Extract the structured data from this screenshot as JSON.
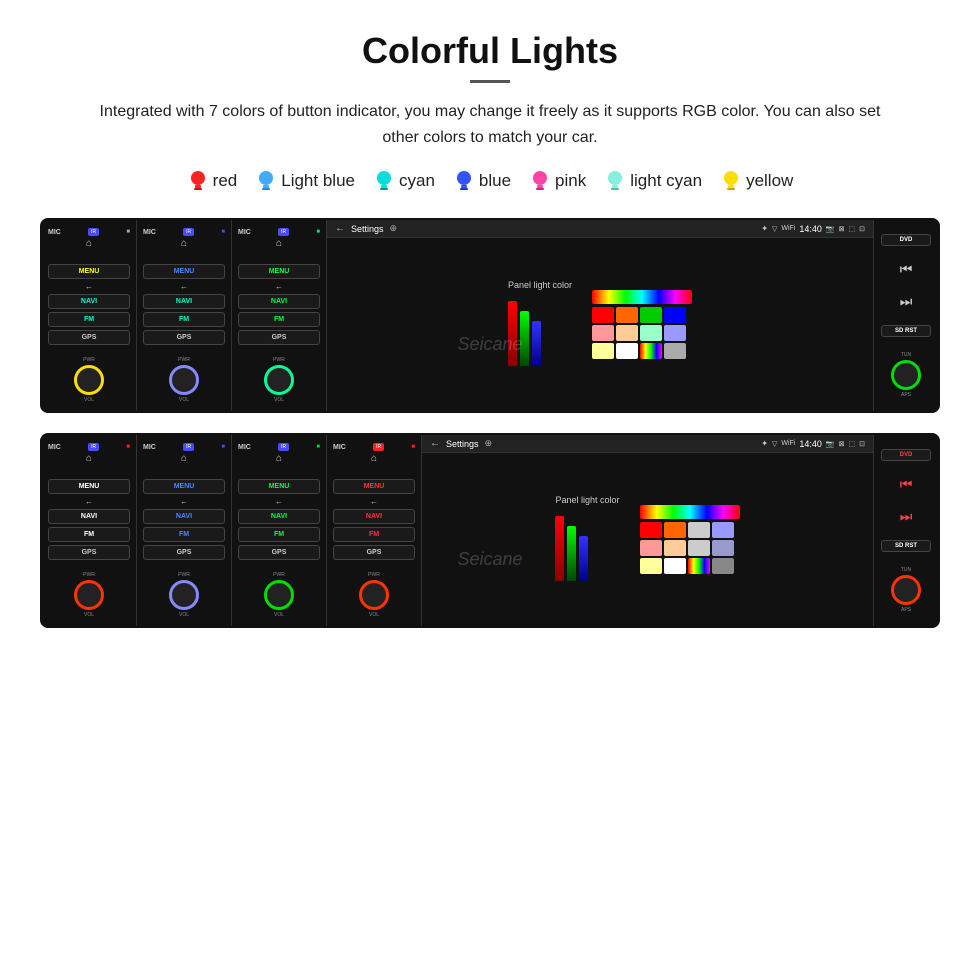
{
  "header": {
    "title": "Colorful Lights",
    "description": "Integrated with 7 colors of button indicator, you may change it freely as it supports RGB color. You can also set other colors to match your car."
  },
  "colors": [
    {
      "name": "red",
      "color": "#ff2222",
      "label": "red"
    },
    {
      "name": "light-blue",
      "color": "#44aaff",
      "label": "Light blue"
    },
    {
      "name": "cyan",
      "color": "#00dddd",
      "label": "cyan"
    },
    {
      "name": "blue",
      "color": "#3355ff",
      "label": "blue"
    },
    {
      "name": "pink",
      "color": "#ff44aa",
      "label": "pink"
    },
    {
      "name": "light-cyan",
      "color": "#88eedd",
      "label": "light cyan"
    },
    {
      "name": "yellow",
      "color": "#ffdd00",
      "label": "yellow"
    }
  ],
  "unit": {
    "mic_label": "MIC",
    "ir_label": "IR",
    "menu": "MENU",
    "navi": "NAVI",
    "fm": "FM",
    "gps": "GPS",
    "pwr": "PWR",
    "vol": "VOL",
    "dvd": "DVD",
    "sd_rst": "SD RST",
    "tun": "TUN",
    "aps": "APS",
    "settings": "Settings",
    "time": "14:40",
    "panel_light_color": "Panel light color"
  },
  "watermark": "Seicane"
}
